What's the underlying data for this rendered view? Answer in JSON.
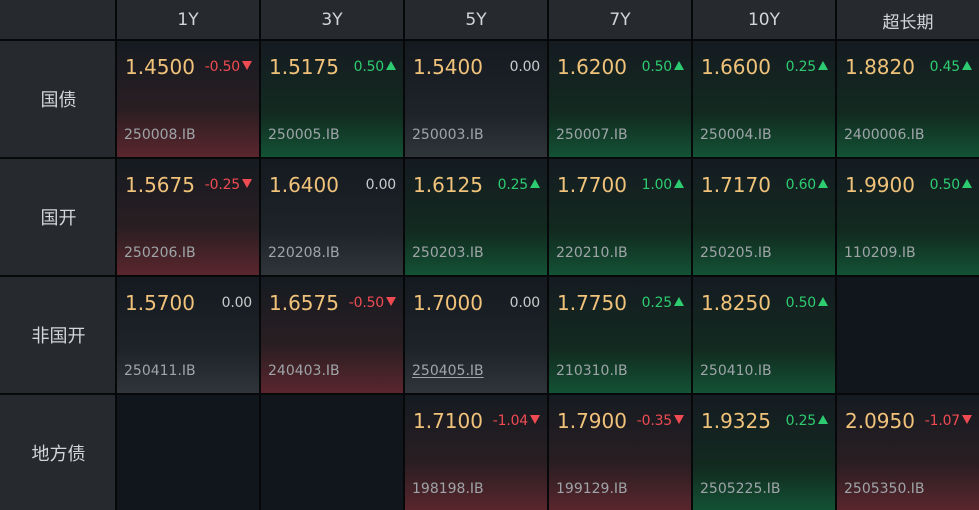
{
  "colors": {
    "background": "#060809",
    "header_background": "#262a2e",
    "yield_text": "#f0c27a",
    "up": "#2ecc71",
    "down": "#ef4b52",
    "flat": "#c8cbcc",
    "code_text": "#9ea4a8"
  },
  "columns": [
    "1Y",
    "3Y",
    "5Y",
    "7Y",
    "10Y",
    "超长期"
  ],
  "rows": [
    {
      "label": "国债",
      "cells": [
        {
          "yield": "1.4500",
          "change": "-0.50",
          "direction": "down",
          "code": "250008.IB"
        },
        {
          "yield": "1.5175",
          "change": "0.50",
          "direction": "up",
          "code": "250005.IB"
        },
        {
          "yield": "1.5400",
          "change": "0.00",
          "direction": "flat",
          "code": "250003.IB"
        },
        {
          "yield": "1.6200",
          "change": "0.50",
          "direction": "up",
          "code": "250007.IB"
        },
        {
          "yield": "1.6600",
          "change": "0.25",
          "direction": "up",
          "code": "250004.IB"
        },
        {
          "yield": "1.8820",
          "change": "0.45",
          "direction": "up",
          "code": "2400006.IB"
        }
      ]
    },
    {
      "label": "国开",
      "cells": [
        {
          "yield": "1.5675",
          "change": "-0.25",
          "direction": "down",
          "code": "250206.IB"
        },
        {
          "yield": "1.6400",
          "change": "0.00",
          "direction": "flat",
          "code": "220208.IB"
        },
        {
          "yield": "1.6125",
          "change": "0.25",
          "direction": "up",
          "code": "250203.IB"
        },
        {
          "yield": "1.7700",
          "change": "1.00",
          "direction": "up",
          "code": "220210.IB"
        },
        {
          "yield": "1.7170",
          "change": "0.60",
          "direction": "up",
          "code": "250205.IB"
        },
        {
          "yield": "1.9900",
          "change": "0.50",
          "direction": "up",
          "code": "110209.IB"
        }
      ]
    },
    {
      "label": "非国开",
      "cells": [
        {
          "yield": "1.5700",
          "change": "0.00",
          "direction": "flat",
          "code": "250411.IB"
        },
        {
          "yield": "1.6575",
          "change": "-0.50",
          "direction": "down",
          "code": "240403.IB"
        },
        {
          "yield": "1.7000",
          "change": "0.00",
          "direction": "flat",
          "code": "250405.IB"
        },
        {
          "yield": "1.7750",
          "change": "0.25",
          "direction": "up",
          "code": "210310.IB"
        },
        {
          "yield": "1.8250",
          "change": "0.50",
          "direction": "up",
          "code": "250410.IB"
        },
        {
          "yield": "",
          "change": "",
          "direction": "empty",
          "code": ""
        }
      ]
    },
    {
      "label": "地方债",
      "cells": [
        {
          "yield": "",
          "change": "",
          "direction": "empty",
          "code": ""
        },
        {
          "yield": "",
          "change": "",
          "direction": "empty",
          "code": ""
        },
        {
          "yield": "1.7100",
          "change": "-1.04",
          "direction": "down",
          "code": "198198.IB"
        },
        {
          "yield": "1.7900",
          "change": "-0.35",
          "direction": "down",
          "code": "199129.IB"
        },
        {
          "yield": "1.9325",
          "change": "0.25",
          "direction": "up",
          "code": "2505225.IB"
        },
        {
          "yield": "2.0950",
          "change": "-1.07",
          "direction": "down",
          "code": "2505350.IB"
        }
      ]
    }
  ]
}
